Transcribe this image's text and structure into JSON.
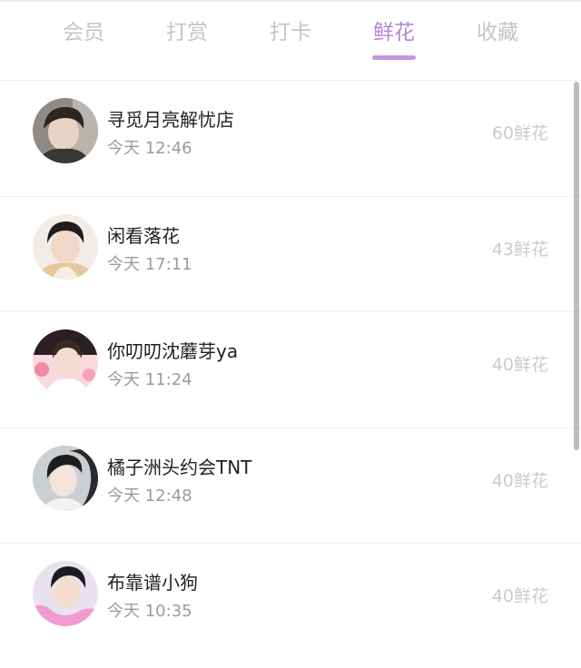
{
  "tabs": [
    {
      "label": "会员"
    },
    {
      "label": "打赏"
    },
    {
      "label": "打卡"
    },
    {
      "label": "鲜花"
    },
    {
      "label": "收藏"
    }
  ],
  "active_tab": "鲜花",
  "accent_color": "#b485d6",
  "rows": [
    {
      "name": "寻觅月亮解忧店",
      "time": "今天 12:46",
      "amount": "60鲜花"
    },
    {
      "name": "闲看落花",
      "time": "今天 17:11",
      "amount": "43鲜花"
    },
    {
      "name": "你叨叨沈蘑芽ya",
      "time": "今天 11:24",
      "amount": "40鲜花"
    },
    {
      "name": "橘子洲头约会TNT",
      "time": "今天 12:48",
      "amount": "40鲜花"
    },
    {
      "name": "布靠谱小狗",
      "time": "今天 10:35",
      "amount": "40鲜花"
    }
  ]
}
